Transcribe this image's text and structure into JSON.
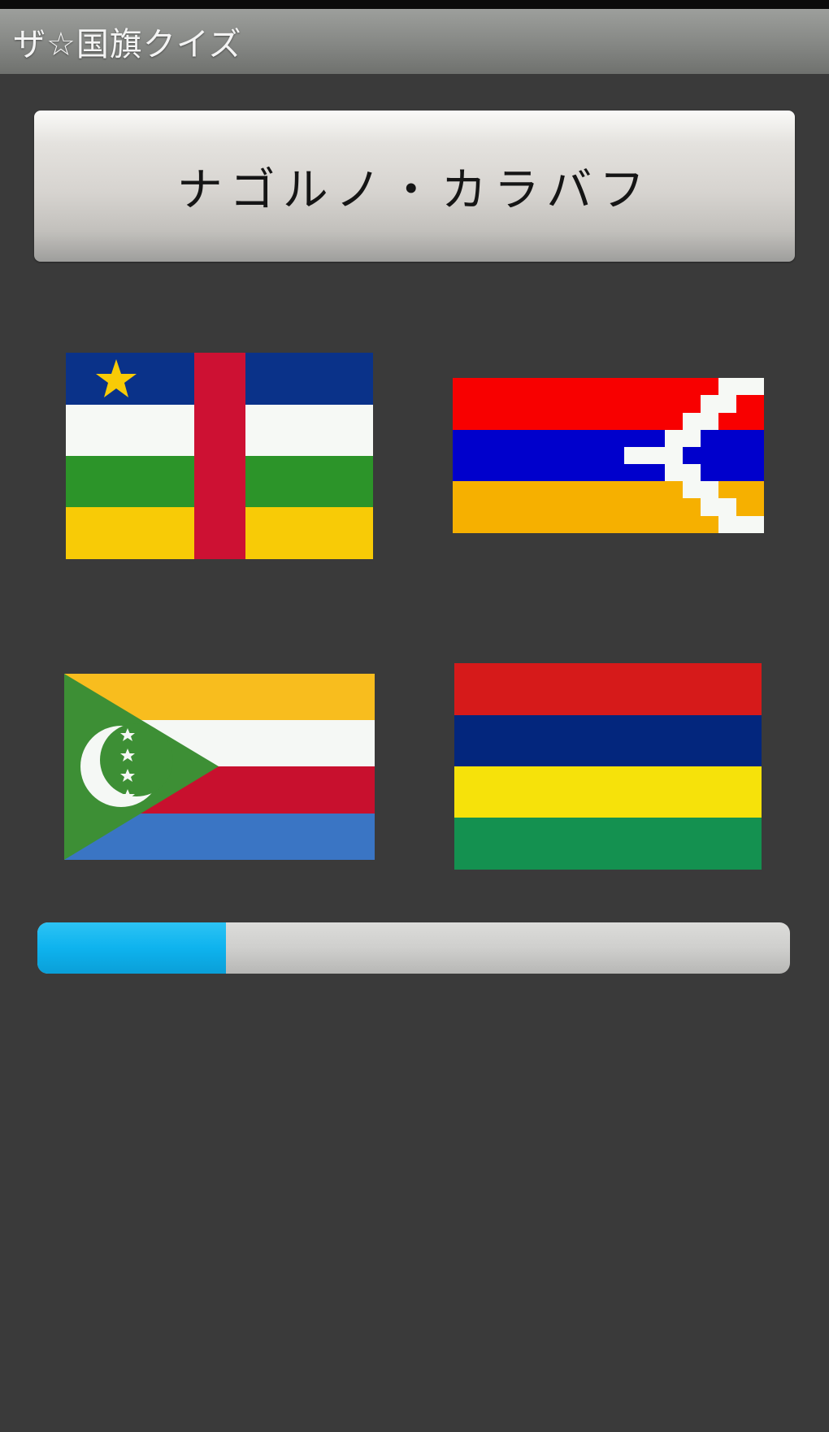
{
  "app": {
    "title": "ザ☆国旗クイズ"
  },
  "question": {
    "country_name": "ナゴルノ・カラバフ"
  },
  "choices": [
    {
      "flag": "central-african-republic"
    },
    {
      "flag": "nagorno-karabakh"
    },
    {
      "flag": "comoros"
    },
    {
      "flag": "mauritius"
    }
  ],
  "progress": {
    "fraction": 0.25,
    "fill_color": "#0fb4ef"
  },
  "colors": {
    "background": "#3a3a3a",
    "title_bar": "#868885",
    "button": "#d6d3cf"
  }
}
